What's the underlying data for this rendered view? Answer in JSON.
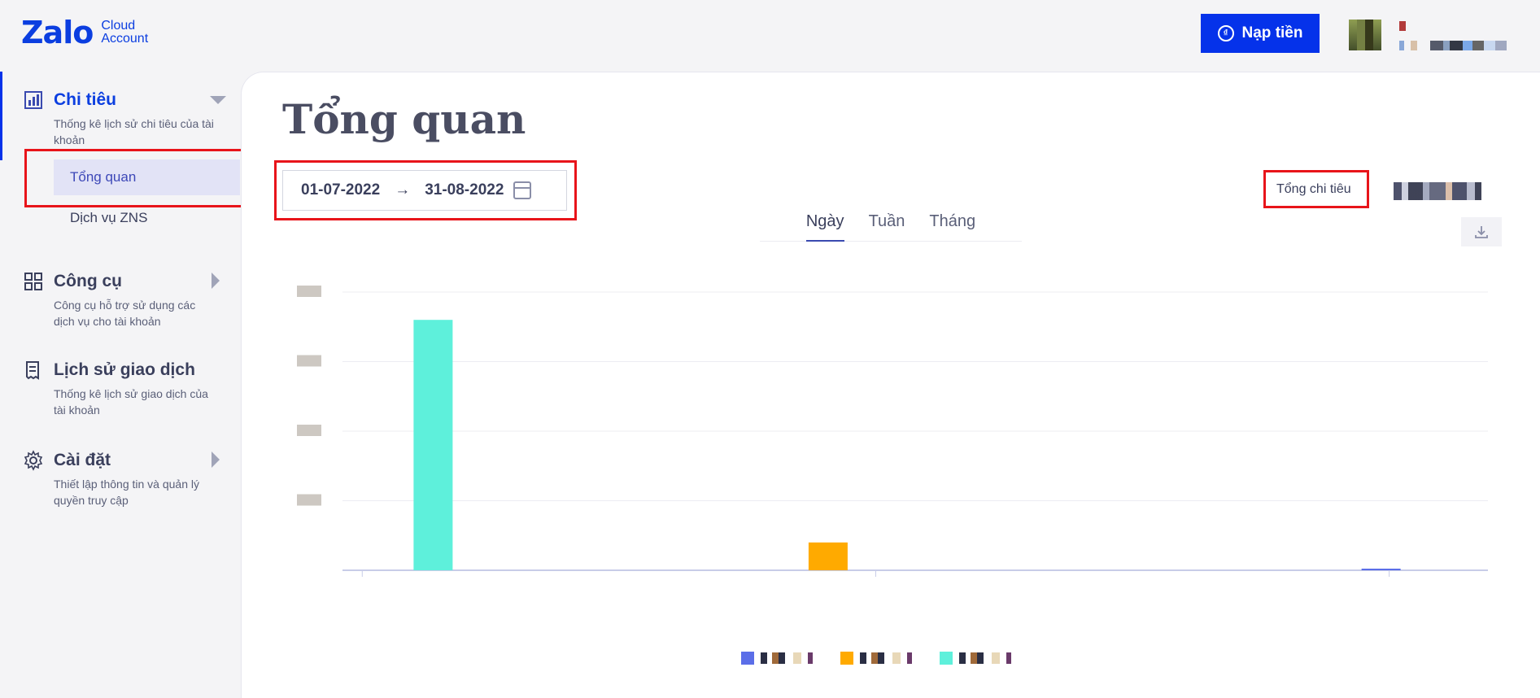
{
  "app": {
    "logo_main": "Zalo",
    "logo_sub_line1": "Cloud",
    "logo_sub_line2": "Account"
  },
  "header": {
    "topup_label": "Nạp tiền",
    "topup_icon": "dong-coin-icon"
  },
  "sidebar": {
    "groups": [
      {
        "title": "Chi tiêu",
        "desc": "Thống kê lịch sử chi tiêu của tài khoản",
        "icon": "chart-report-icon",
        "expanded": true
      },
      {
        "title": "Công cụ",
        "desc": "Công cụ hỗ trợ sử dụng các dịch vụ cho tài khoản",
        "icon": "grid-apps-icon",
        "expanded": false
      },
      {
        "title": "Lịch sử giao dịch",
        "desc": "Thống kê lịch sử giao dịch của tài khoản",
        "icon": "receipt-icon",
        "expanded": false
      },
      {
        "title": "Cài đặt",
        "desc": "Thiết lập thông tin và quản lý quyền truy cập",
        "icon": "gear-icon",
        "expanded": false
      }
    ],
    "subitems": [
      {
        "label": "Tổng quan",
        "selected": true
      },
      {
        "label": "Dịch vụ ZNS",
        "selected": false
      }
    ]
  },
  "main": {
    "title": "Tổng quan",
    "date_from": "01-07-2022",
    "date_arrow": "→",
    "date_to": "31-08-2022",
    "total_label": "Tổng chi tiêu",
    "tabs": [
      {
        "label": "Ngày",
        "active": true
      },
      {
        "label": "Tuần",
        "active": false
      },
      {
        "label": "Tháng",
        "active": false
      }
    ]
  },
  "colors": {
    "brand": "#0532ea",
    "series1": "#5b6ee8",
    "series2": "#ffaa00",
    "series3": "#5ef0db",
    "highlight_box": "#e8141a"
  },
  "chart_data": {
    "type": "bar",
    "y_label_count": 5,
    "gridlines": true,
    "bars": [
      {
        "series": 3,
        "x_index": 1,
        "value": 0.9
      },
      {
        "series": 2,
        "x_index": 11,
        "value": 0.1
      },
      {
        "series": 1,
        "x_index": 25,
        "value": 0.005
      }
    ],
    "x_slots": 29,
    "ylim": [
      0,
      1
    ]
  }
}
